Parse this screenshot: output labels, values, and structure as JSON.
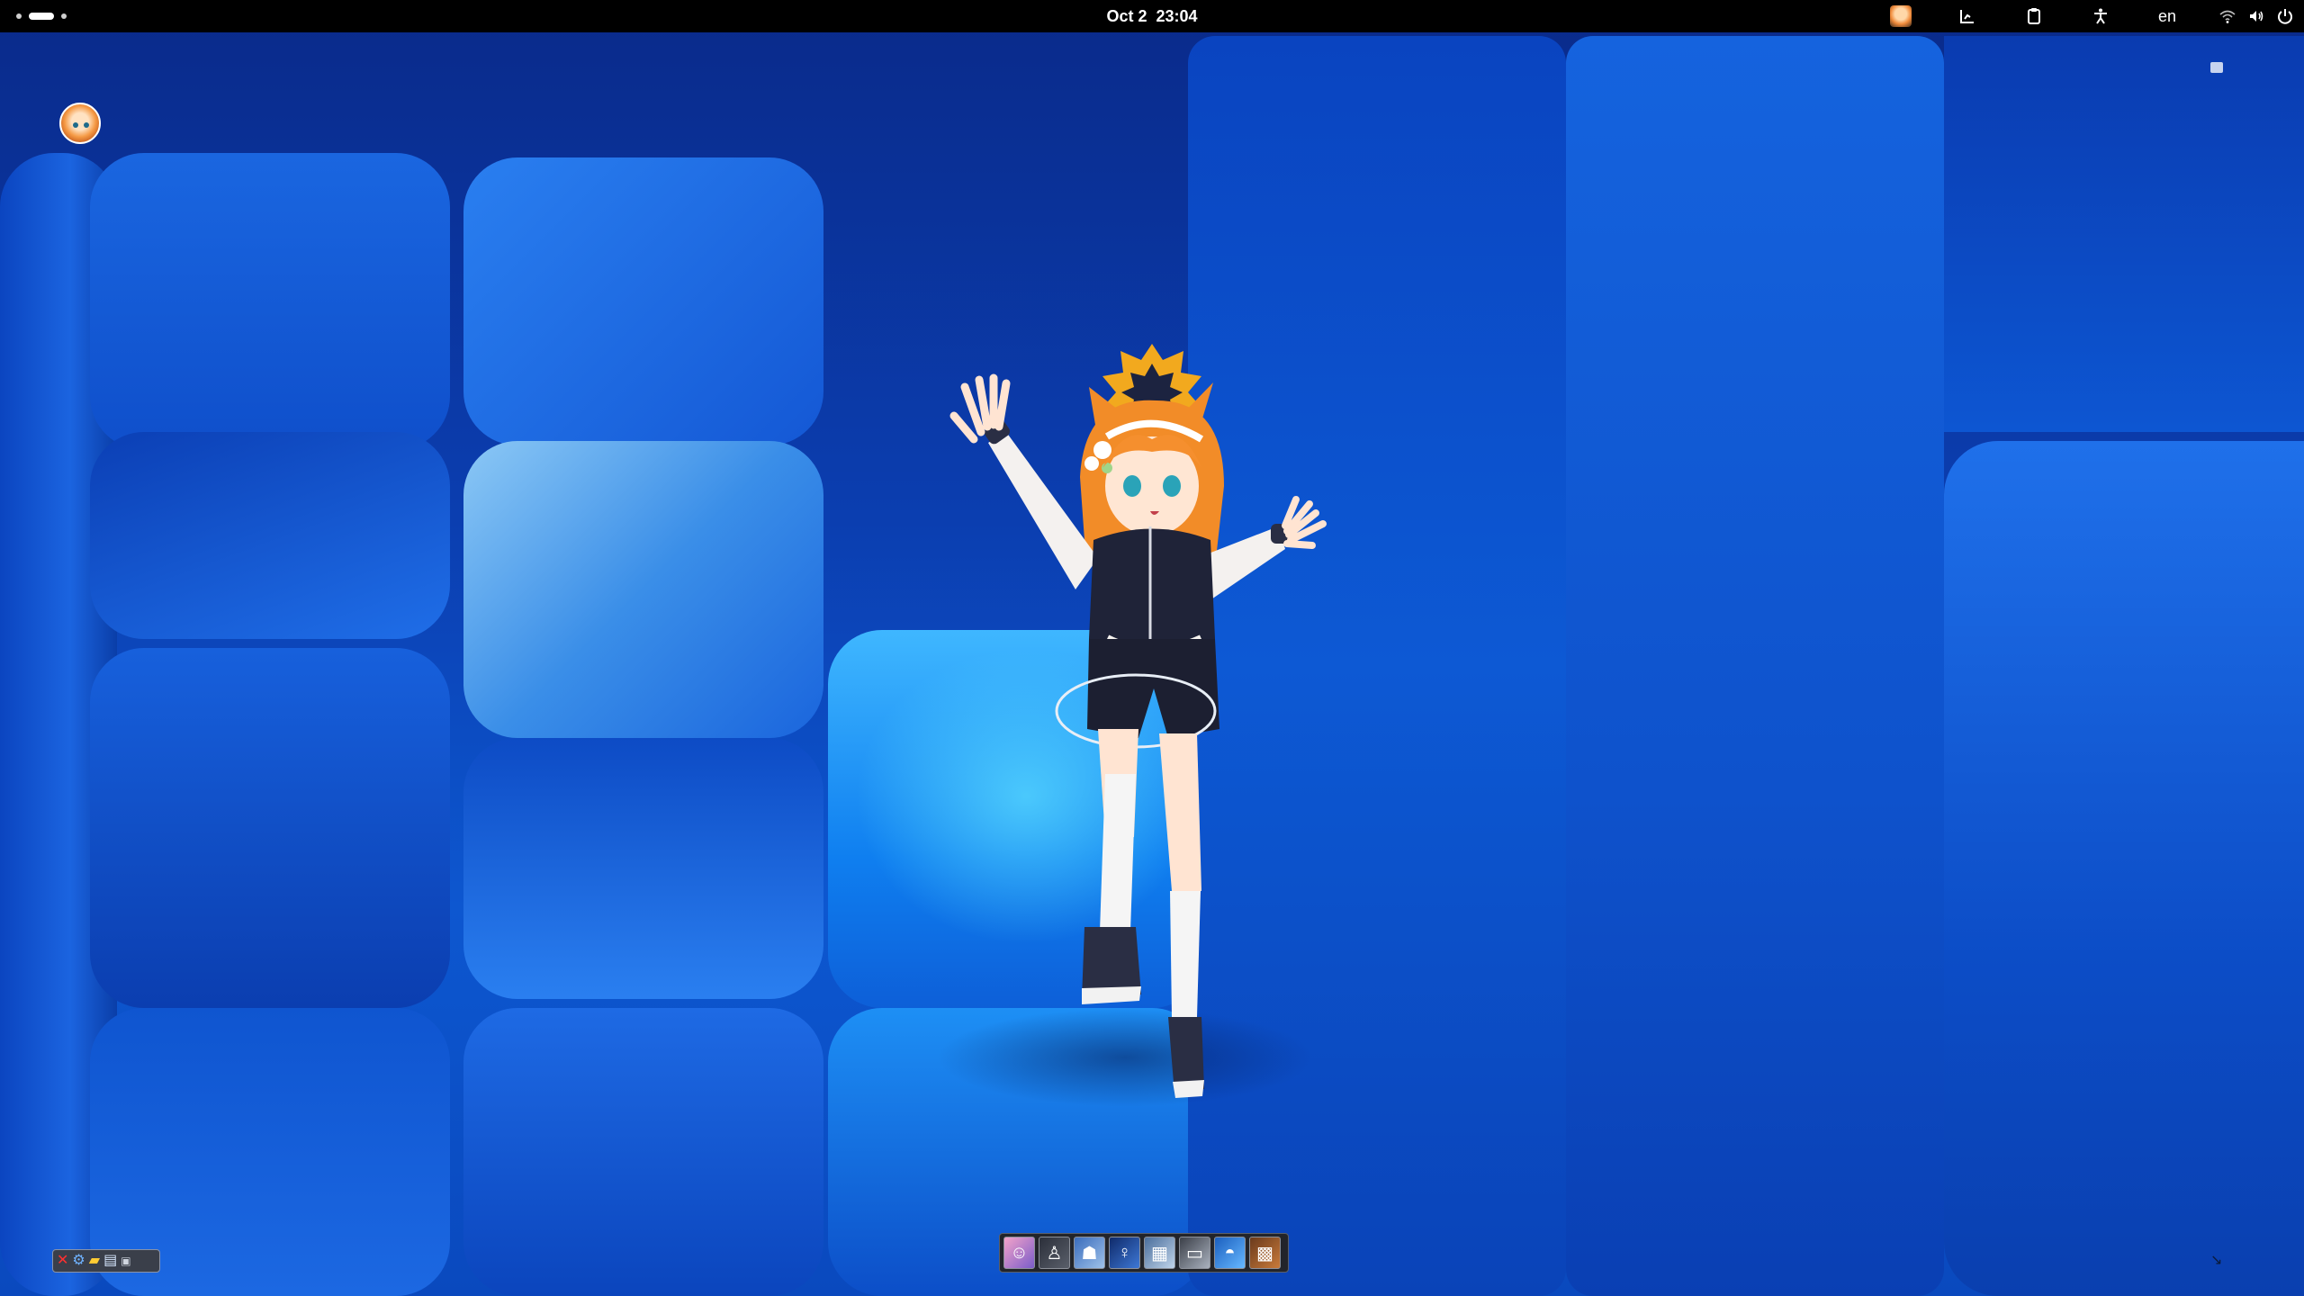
{
  "topbar": {
    "date": "Oct 2",
    "time": "23:04",
    "language": "en"
  },
  "tray_icons": [
    "user-avatar-icon",
    "screenshot-icon",
    "clipboard-icon",
    "accessibility-icon",
    "network-icon",
    "volume-icon",
    "power-icon"
  ],
  "mini_tray": {
    "items": [
      "close-icon",
      "settings-icon",
      "folder-icon",
      "window-icon",
      "terminal-icon"
    ]
  },
  "dock": {
    "items": [
      "app-character-editor",
      "app-pose",
      "app-stage",
      "app-figure",
      "app-screen-capture",
      "app-monitor",
      "app-scene",
      "app-box"
    ]
  },
  "colors": {
    "topbar_bg": "#000000",
    "wallpaper_accent": "#0d57d0",
    "glow": "#3fb7ff"
  }
}
